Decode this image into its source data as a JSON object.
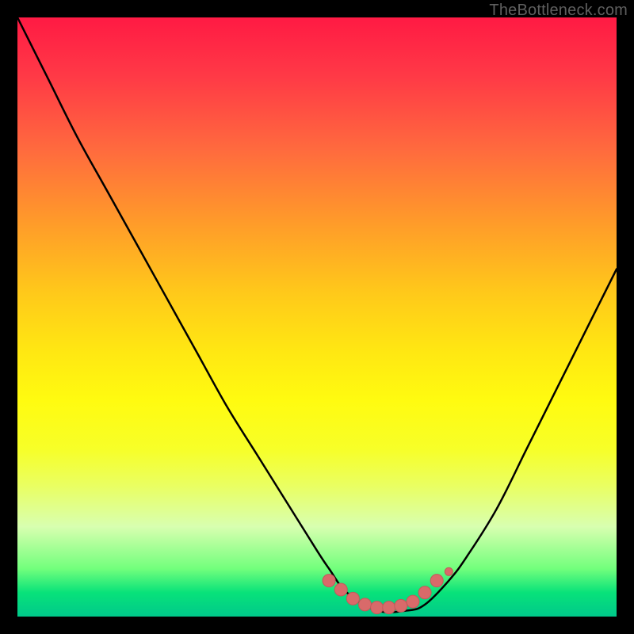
{
  "watermark": {
    "text": "TheBottleneck.com"
  },
  "colors": {
    "black": "#000000",
    "curve_stroke": "#000000",
    "marker_fill": "#d96a6a",
    "marker_stroke": "#c25a5a"
  },
  "chart_data": {
    "type": "line",
    "title": "",
    "xlabel": "",
    "ylabel": "",
    "xlim": [
      0,
      100
    ],
    "ylim": [
      0,
      100
    ],
    "series": [
      {
        "name": "bottleneck-curve",
        "x": [
          0,
          5,
          10,
          15,
          20,
          25,
          30,
          35,
          40,
          45,
          50,
          52,
          55,
          60,
          65,
          68,
          72,
          75,
          80,
          85,
          90,
          95,
          100
        ],
        "values": [
          100,
          90,
          80,
          71,
          62,
          53,
          44,
          35,
          27,
          19,
          11,
          8,
          4,
          1,
          1,
          2,
          6,
          10,
          18,
          28,
          38,
          48,
          58
        ]
      }
    ],
    "markers": {
      "name": "optimal-zone",
      "x": [
        52,
        54,
        56,
        58,
        60,
        62,
        64,
        66,
        68,
        70
      ],
      "values": [
        6,
        4.5,
        3,
        2,
        1.5,
        1.5,
        1.8,
        2.5,
        4,
        6
      ]
    }
  }
}
